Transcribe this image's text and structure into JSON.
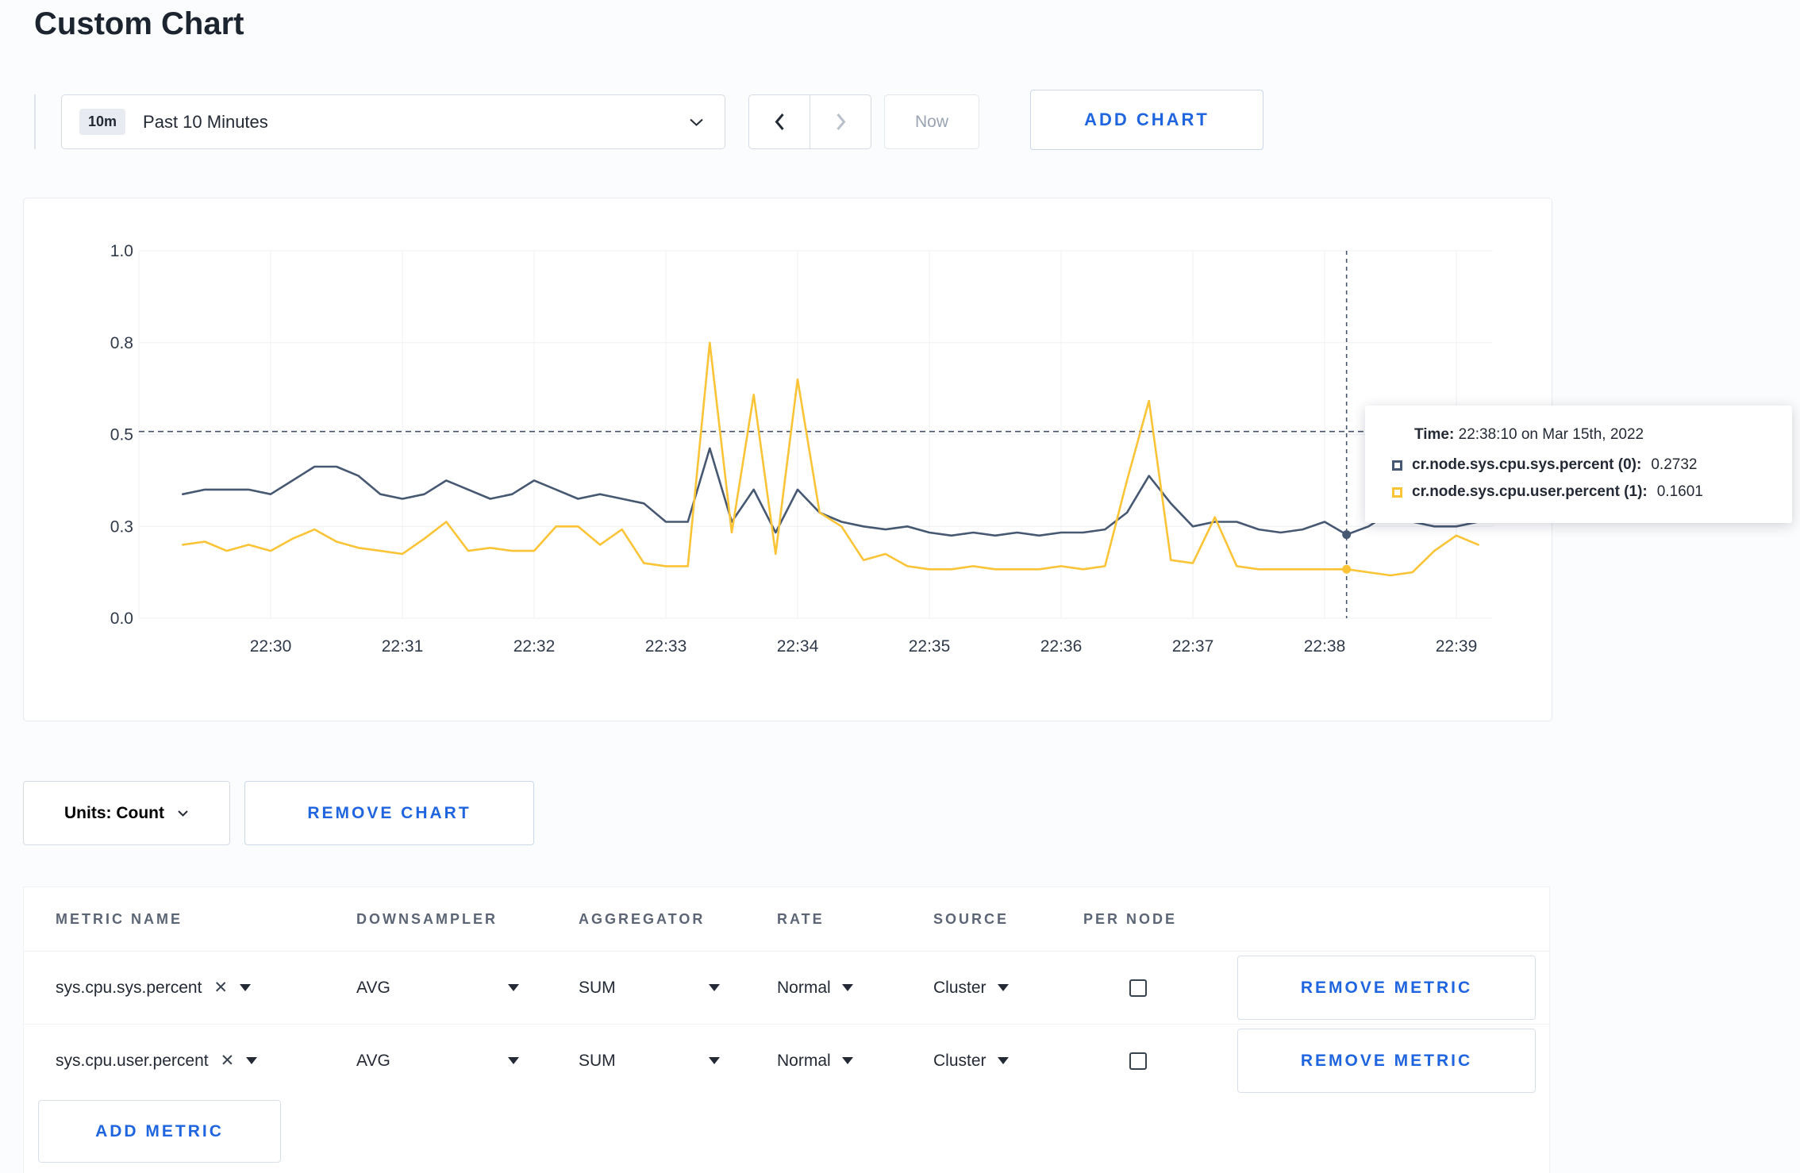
{
  "page": {
    "title": "Custom Chart"
  },
  "toolbar": {
    "time_range_badge": "10m",
    "time_range_label": "Past 10 Minutes",
    "now_label": "Now",
    "add_chart_label": "ADD CHART"
  },
  "icons": {
    "clear_metric": "✕"
  },
  "colors": {
    "accent": "#2065e0",
    "series_sys": "#475872",
    "series_user": "#fbc437",
    "grid": "#edf0f4",
    "ruler": "#46536b"
  },
  "chart_data": {
    "type": "line",
    "title": "",
    "xlabel": "",
    "ylabel": "",
    "ylim": [
      0.0,
      1.0
    ],
    "grid": true,
    "legend_position": "hidden",
    "x_ticks": [
      "22:30",
      "22:31",
      "22:32",
      "22:33",
      "22:34",
      "22:35",
      "22:36",
      "22:37",
      "22:38",
      "22:39"
    ],
    "y_ticks": [
      "1.0",
      "0.8",
      "0.5",
      "0.3",
      "0.0"
    ],
    "y_tick_values": [
      1.0,
      0.8,
      0.5,
      0.3,
      0.0
    ],
    "threshold_value": 0.51,
    "crosshair_t": 550,
    "crosshair_time_label": "22:38:10",
    "series": [
      {
        "name": "cr.node.sys.cpu.sys.percent",
        "color": "#475872",
        "start_t": 20,
        "step_t": 10,
        "values": [
          0.37,
          0.38,
          0.38,
          0.38,
          0.37,
          0.4,
          0.43,
          0.43,
          0.41,
          0.37,
          0.36,
          0.37,
          0.4,
          0.38,
          0.36,
          0.37,
          0.4,
          0.38,
          0.36,
          0.37,
          0.36,
          0.35,
          0.31,
          0.31,
          0.47,
          0.31,
          0.38,
          0.28,
          0.38,
          0.33,
          0.31,
          0.3,
          0.29,
          0.3,
          0.28,
          0.27,
          0.28,
          0.27,
          0.28,
          0.27,
          0.28,
          0.28,
          0.29,
          0.33,
          0.41,
          0.35,
          0.3,
          0.31,
          0.31,
          0.29,
          0.28,
          0.29,
          0.31,
          0.2732,
          0.3,
          0.33,
          0.31,
          0.3,
          0.3,
          0.31
        ]
      },
      {
        "name": "cr.node.sys.cpu.user.percent",
        "color": "#fbc437",
        "start_t": 20,
        "step_t": 10,
        "values": [
          0.24,
          0.25,
          0.22,
          0.24,
          0.22,
          0.26,
          0.29,
          0.25,
          0.23,
          0.22,
          0.21,
          0.26,
          0.31,
          0.22,
          0.23,
          0.22,
          0.22,
          0.3,
          0.3,
          0.24,
          0.29,
          0.18,
          0.17,
          0.17,
          0.8,
          0.28,
          0.63,
          0.21,
          0.68,
          0.33,
          0.3,
          0.19,
          0.21,
          0.17,
          0.16,
          0.16,
          0.17,
          0.16,
          0.16,
          0.16,
          0.17,
          0.16,
          0.17,
          0.4,
          0.61,
          0.19,
          0.18,
          0.32,
          0.17,
          0.16,
          0.16,
          0.16,
          0.16,
          0.1601,
          0.15,
          0.14,
          0.15,
          0.22,
          0.27,
          0.24
        ]
      }
    ]
  },
  "tooltip": {
    "time_label": "Time:",
    "time_value": "22:38:10 on Mar 15th, 2022",
    "rows": [
      {
        "label": "cr.node.sys.cpu.sys.percent (0):",
        "value": "0.2732",
        "color": "#475872"
      },
      {
        "label": "cr.node.sys.cpu.user.percent (1):",
        "value": "0.1601",
        "color": "#fbc437"
      }
    ]
  },
  "chart_controls": {
    "units_label": "Units: Count",
    "remove_chart_label": "REMOVE CHART"
  },
  "metrics_table": {
    "headers": [
      "METRIC NAME",
      "DOWNSAMPLER",
      "AGGREGATOR",
      "RATE",
      "SOURCE",
      "PER NODE"
    ],
    "rows": [
      {
        "metric": "sys.cpu.sys.percent",
        "downsampler": "AVG",
        "aggregator": "SUM",
        "rate": "Normal",
        "source": "Cluster",
        "per_node": false,
        "remove_label": "REMOVE METRIC"
      },
      {
        "metric": "sys.cpu.user.percent",
        "downsampler": "AVG",
        "aggregator": "SUM",
        "rate": "Normal",
        "source": "Cluster",
        "per_node": false,
        "remove_label": "REMOVE METRIC"
      }
    ],
    "add_metric_label": "ADD METRIC"
  }
}
